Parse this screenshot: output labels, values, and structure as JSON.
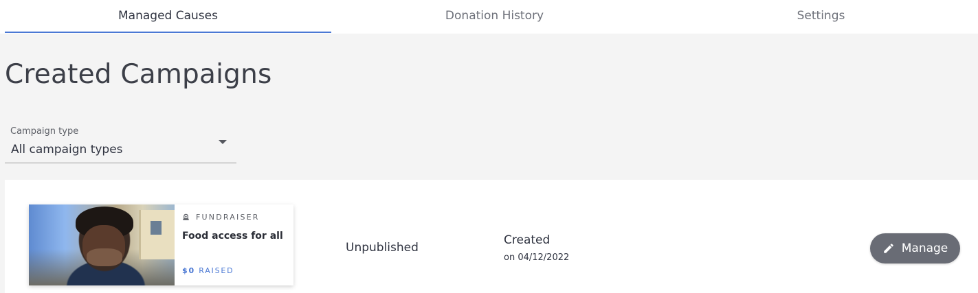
{
  "tabs": [
    {
      "label": "Managed Causes",
      "active": true
    },
    {
      "label": "Donation History",
      "active": false
    },
    {
      "label": "Settings",
      "active": false
    }
  ],
  "page_title": "Created Campaigns",
  "filter": {
    "label": "Campaign type",
    "value": "All campaign types",
    "icon": "chevron-down-icon"
  },
  "campaign": {
    "type": "FUNDRAISER",
    "type_icon": "fundraiser-icon",
    "title": "Food access for all",
    "raised_amount": "$0",
    "raised_label": "RAISED",
    "status": "Unpublished",
    "created_label": "Created",
    "created_date": "on 04/12/2022",
    "manage_label": "Manage",
    "manage_icon": "pencil-icon"
  },
  "colors": {
    "accent": "#4a78d4",
    "button": "#696c75",
    "background": "#f4f4f4"
  }
}
